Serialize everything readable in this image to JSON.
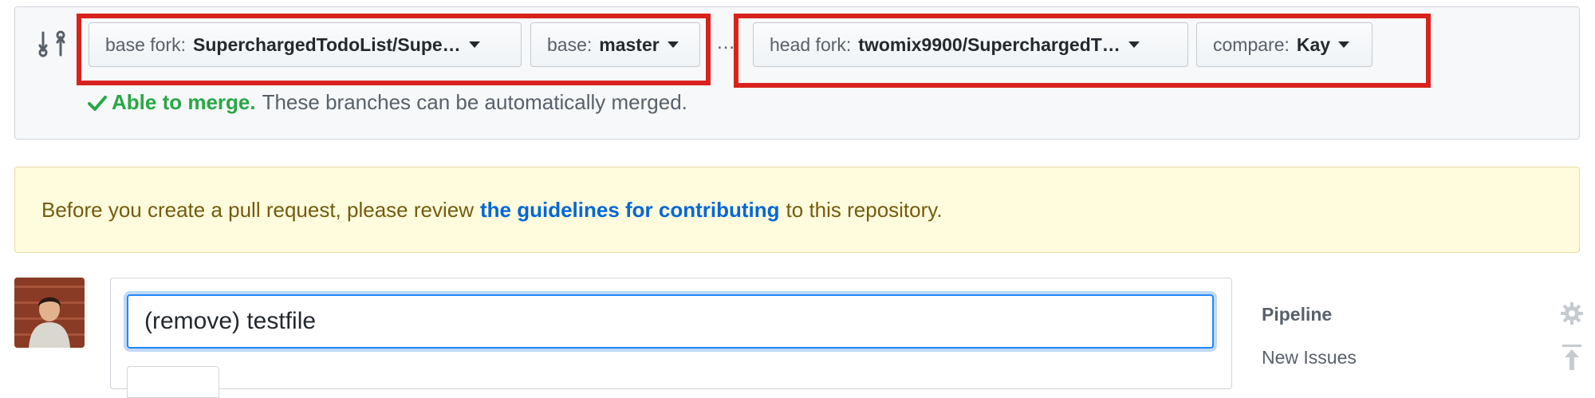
{
  "compare": {
    "base_fork": {
      "prefix": "base fork:",
      "value": "SuperchargedTodoList/Supe…"
    },
    "base": {
      "prefix": "base:",
      "value": "master"
    },
    "separator": "…",
    "head_fork": {
      "prefix": "head fork:",
      "value": "twomix9900/SuperchargedT…"
    },
    "compare_branch": {
      "prefix": "compare:",
      "value": "Kay"
    },
    "merge": {
      "status": "Able to merge.",
      "description": "These branches can be automatically merged."
    }
  },
  "flash": {
    "before": "Before you create a pull request, please review",
    "link": "the guidelines for contributing",
    "after": "to this repository."
  },
  "pr_form": {
    "title_value": "(remove) testfile"
  },
  "sidebar": {
    "title": "Pipeline",
    "subtitle": "New Issues"
  },
  "colors": {
    "highlight": "#d8231d",
    "merge_ok": "#28a745",
    "link": "#0366d6",
    "flash_bg": "#fffbdd"
  },
  "icons": [
    "git-compare-icon",
    "caret-down-icon",
    "check-icon",
    "gear-icon",
    "pin-icon"
  ]
}
